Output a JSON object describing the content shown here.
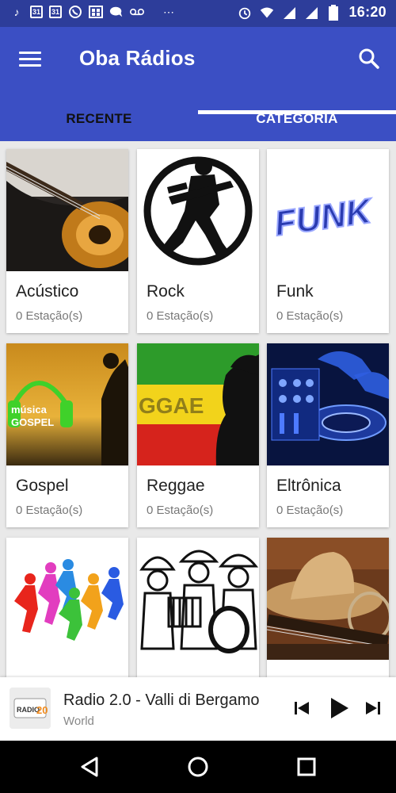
{
  "status_bar": {
    "left_icons": [
      "music-note-icon",
      "calendar-icon",
      "calendar-icon",
      "whatsapp-icon",
      "gallery-icon",
      "chat-icon",
      "voicemail-icon",
      "more-icon"
    ],
    "calendar_day": "31",
    "right_icons": [
      "alarm-icon",
      "wifi-icon",
      "signal-icon",
      "signal-icon",
      "battery-icon"
    ],
    "time": "16:20"
  },
  "app_bar": {
    "title": "Oba Rádios",
    "menu_icon": "menu-icon",
    "search_icon": "search-icon"
  },
  "tabs": [
    {
      "label": "RECENTE",
      "active": false
    },
    {
      "label": "CATEGORIA",
      "active": true
    }
  ],
  "colors": {
    "primary": "#3b4fc4",
    "status_bar": "#2d3d9a",
    "background": "#e9e9e9"
  },
  "categories": [
    {
      "name": "Acústico",
      "count": "0 Estação(s)",
      "image": "acoustic-guitar-image"
    },
    {
      "name": "Rock",
      "count": "0 Estação(s)",
      "image": "rock-guitarist-image"
    },
    {
      "name": "Funk",
      "count": "0 Estação(s)",
      "image": "funk-logo-image",
      "image_text": "FUNK"
    },
    {
      "name": "Gospel",
      "count": "0 Estação(s)",
      "image": "gospel-headphones-image",
      "image_text": "música GOSPEL"
    },
    {
      "name": "Reggae",
      "count": "0 Estação(s)",
      "image": "reggae-flag-image",
      "image_text": "GGAE"
    },
    {
      "name": "Eltrônica",
      "count": "0 Estação(s)",
      "image": "dj-mixer-image"
    },
    {
      "name": "",
      "count": "",
      "image": "dancers-image"
    },
    {
      "name": "",
      "count": "",
      "image": "forro-band-image"
    },
    {
      "name": "",
      "count": "",
      "image": "country-hat-guitar-image"
    }
  ],
  "player": {
    "thumb_text": "RADIO 2.0",
    "title": "Radio 2.0 - Valli di Bergamo",
    "subtitle": "World",
    "controls": [
      "skip-previous-icon",
      "play-icon",
      "skip-next-icon"
    ]
  },
  "nav_bar": {
    "buttons": [
      "back-icon",
      "home-icon",
      "recents-icon"
    ]
  }
}
